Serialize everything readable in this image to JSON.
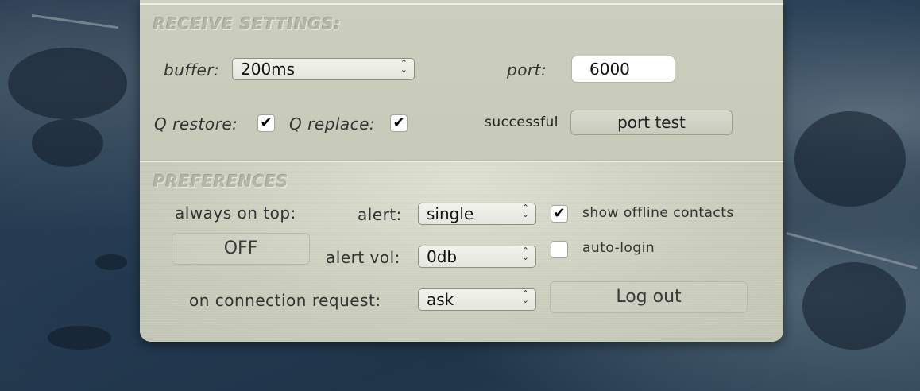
{
  "receive": {
    "title": "RECEIVE SETTINGS:",
    "buffer_label": "buffer:",
    "buffer_value": "200ms",
    "port_label": "port:",
    "port_value": "6000",
    "q_restore_label": "Q restore:",
    "q_restore_checked": true,
    "q_replace_label": "Q replace:",
    "q_replace_checked": true,
    "status_text": "successful",
    "port_test_label": "port test"
  },
  "preferences": {
    "title": "PREFERENCES",
    "always_on_top_label": "always on top:",
    "always_on_top_button": "OFF",
    "alert_label": "alert:",
    "alert_value": "single",
    "alert_vol_label": "alert vol:",
    "alert_vol_value": "0db",
    "connection_label": "on connection request:",
    "connection_value": "ask",
    "show_offline_label": "show offline contacts",
    "show_offline_checked": true,
    "auto_login_label": "auto-login",
    "auto_login_checked": false,
    "logout_label": "Log out"
  },
  "icons": {
    "checkmark": "✔",
    "select_chevron": "up-down-chevron-icon"
  }
}
